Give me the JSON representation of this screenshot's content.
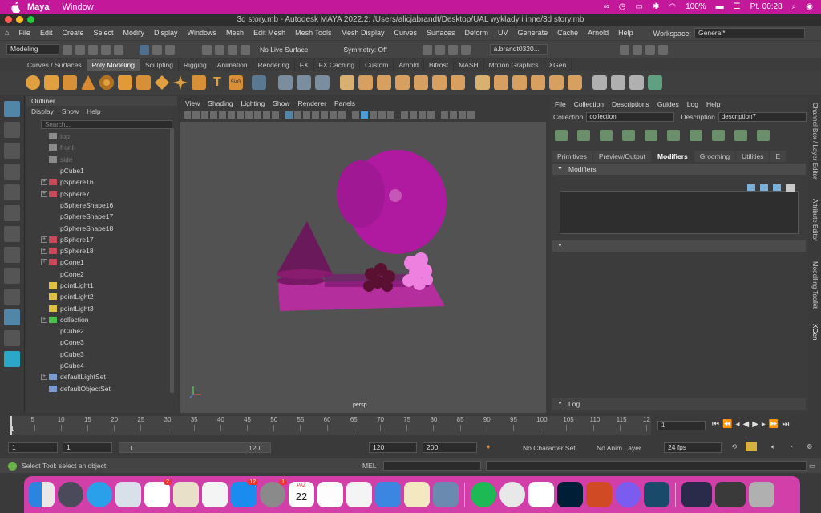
{
  "mac_menubar": {
    "app_name": "Maya",
    "menus": [
      "Window"
    ],
    "status": {
      "battery": "100%",
      "clock": "Pt. 00:28"
    }
  },
  "window_title": "3d story.mb - Autodesk MAYA 2022.2: /Users/alicjabrandt/Desktop/UAL wyklady  i inne/3d story.mb",
  "main_menu": [
    "File",
    "Edit",
    "Create",
    "Select",
    "Modify",
    "Display",
    "Windows",
    "Mesh",
    "Edit Mesh",
    "Mesh Tools",
    "Mesh Display",
    "Curves",
    "Surfaces",
    "Deform",
    "UV",
    "Generate",
    "Cache",
    "Arnold",
    "Help"
  ],
  "workspace": {
    "label": "Workspace:",
    "value": "General*"
  },
  "status_line": {
    "mode": "Modeling",
    "live_surface": "No Live Surface",
    "symmetry": "Symmetry: Off",
    "user": "a.brandt0320..."
  },
  "shelf_tabs": [
    "Curves / Surfaces",
    "Poly Modeling",
    "Sculpting",
    "Rigging",
    "Animation",
    "Rendering",
    "FX",
    "FX Caching",
    "Custom",
    "Arnold",
    "Bifrost",
    "MASH",
    "Motion Graphics",
    "XGen"
  ],
  "shelf_active": "Poly Modeling",
  "outliner": {
    "title": "Outliner",
    "menu": [
      "Display",
      "Show",
      "Help"
    ],
    "search_placeholder": "Search...",
    "items": [
      {
        "label": "top",
        "kind": "camera",
        "dim": true,
        "expand": false
      },
      {
        "label": "front",
        "kind": "camera",
        "dim": true,
        "expand": false
      },
      {
        "label": "side",
        "kind": "camera",
        "dim": true,
        "expand": false
      },
      {
        "label": "pCube1",
        "kind": "none",
        "dim": false,
        "expand": false
      },
      {
        "label": "pSphere16",
        "kind": "mesh",
        "dim": false,
        "expand": true
      },
      {
        "label": "pSphere7",
        "kind": "mesh",
        "dim": false,
        "expand": true
      },
      {
        "label": "pSphereShape16",
        "kind": "none",
        "dim": false,
        "expand": false
      },
      {
        "label": "pSphereShape17",
        "kind": "none",
        "dim": false,
        "expand": false
      },
      {
        "label": "pSphereShape18",
        "kind": "none",
        "dim": false,
        "expand": false
      },
      {
        "label": "pSphere17",
        "kind": "mesh",
        "dim": false,
        "expand": true
      },
      {
        "label": "pSphere18",
        "kind": "mesh",
        "dim": false,
        "expand": true
      },
      {
        "label": "pCone1",
        "kind": "mesh",
        "dim": false,
        "expand": true
      },
      {
        "label": "pCone2",
        "kind": "none",
        "dim": false,
        "expand": false
      },
      {
        "label": "pointLight1",
        "kind": "light",
        "dim": false,
        "expand": false
      },
      {
        "label": "pointLight2",
        "kind": "light",
        "dim": false,
        "expand": false
      },
      {
        "label": "pointLight3",
        "kind": "light",
        "dim": false,
        "expand": false
      },
      {
        "label": "collection",
        "kind": "xgen",
        "dim": false,
        "expand": true
      },
      {
        "label": "pCube2",
        "kind": "none",
        "dim": false,
        "expand": false
      },
      {
        "label": "pCone3",
        "kind": "none",
        "dim": false,
        "expand": false
      },
      {
        "label": "pCube3",
        "kind": "none",
        "dim": false,
        "expand": false
      },
      {
        "label": "pCube4",
        "kind": "none",
        "dim": false,
        "expand": false
      },
      {
        "label": "defaultLightSet",
        "kind": "set",
        "dim": false,
        "expand": true
      },
      {
        "label": "defaultObjectSet",
        "kind": "set",
        "dim": false,
        "expand": false
      }
    ]
  },
  "viewport": {
    "menu": [
      "View",
      "Shading",
      "Lighting",
      "Show",
      "Renderer",
      "Panels"
    ],
    "camera_label": "persp"
  },
  "xgen": {
    "menu": [
      "File",
      "Collection",
      "Descriptions",
      "Guides",
      "Log",
      "Help"
    ],
    "collection_label": "Collection",
    "collection_value": "collection",
    "description_label": "Description",
    "description_value": "description7",
    "tabs": [
      "Primitives",
      "Preview/Output",
      "Modifiers",
      "Grooming",
      "Utilities",
      "E"
    ],
    "active_tab": "Modifiers",
    "section_modifiers": "Modifiers",
    "section_log": "Log"
  },
  "side_tabs": [
    "Channel Box / Layer Editor",
    "Attribute Editor",
    "Modelling Toolkit",
    "XGen"
  ],
  "timeline": {
    "ticks": [
      "5",
      "10",
      "15",
      "20",
      "25",
      "30",
      "35",
      "40",
      "45",
      "50",
      "55",
      "60",
      "65",
      "70",
      "75",
      "80",
      "85",
      "90",
      "95",
      "100",
      "105",
      "110",
      "115",
      "12"
    ],
    "first_tick": "1",
    "current_frame": "1"
  },
  "range": {
    "start": "1",
    "playback_start": "1",
    "slider_start": "1",
    "slider_end": "120",
    "playback_end": "120",
    "end": "200",
    "character_set": "No Character Set",
    "anim_layer": "No Anim Layer",
    "fps": "24 fps"
  },
  "help_line": {
    "text": "Select Tool: select an object",
    "mel": "MEL"
  },
  "dock": {
    "mail_badge": "2",
    "appstore_badge": "12",
    "sysprefs_badge": "1",
    "calendar_month": "PAŹ",
    "calendar_day": "22"
  },
  "colors": {
    "mac_bar": "#c4189a",
    "dock": "#d23fa8",
    "accent_blue": "#5285a6",
    "scene_magenta": "#b01aa0"
  }
}
